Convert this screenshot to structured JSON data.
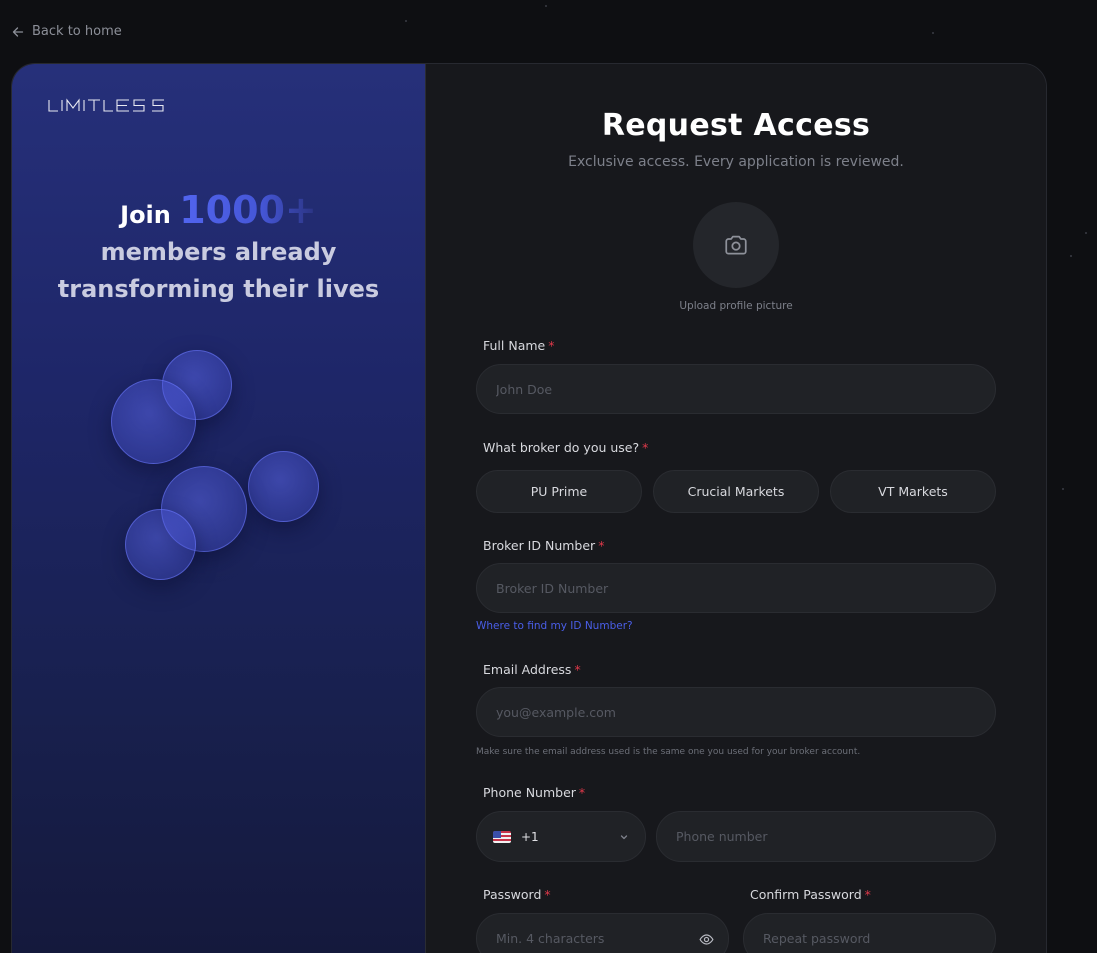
{
  "nav": {
    "back_label": "Back to home"
  },
  "brand": {
    "logo_text": "LIMITLESS"
  },
  "hero": {
    "join": "Join",
    "count": "1000+",
    "line2": "members already",
    "line3": "transforming their lives"
  },
  "form": {
    "title": "Request Access",
    "subtitle": "Exclusive access. Every application is reviewed.",
    "upload_label": "Upload profile picture",
    "full_name": {
      "label": "Full Name",
      "placeholder": "John Doe"
    },
    "broker": {
      "label": "What broker do you use?",
      "options": [
        "PU Prime",
        "Crucial Markets",
        "VT Markets"
      ]
    },
    "broker_id": {
      "label": "Broker ID Number",
      "placeholder": "Broker ID Number",
      "help_link": "Where to find my ID Number?"
    },
    "email": {
      "label": "Email Address",
      "placeholder": "you@example.com",
      "hint": "Make sure the email address used is the same one you used for your broker account."
    },
    "phone": {
      "label": "Phone Number",
      "country_code": "+1",
      "placeholder": "Phone number"
    },
    "password": {
      "label": "Password",
      "placeholder": "Min. 4 characters"
    },
    "confirm_password": {
      "label": "Confirm Password",
      "placeholder": "Repeat password"
    },
    "required_mark": "*"
  },
  "colors": {
    "accent": "#4a5ee8",
    "required": "#e0394a",
    "background": "#0e0f12",
    "card": "#17181c"
  }
}
